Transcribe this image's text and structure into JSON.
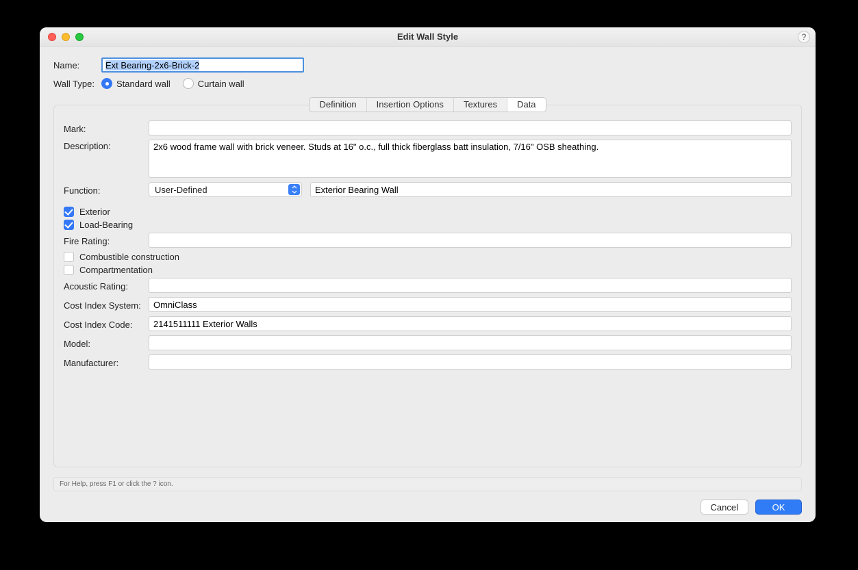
{
  "title": "Edit Wall Style",
  "name_label": "Name:",
  "name_value": "Ext Bearing-2x6-Brick-2",
  "wall_type_label": "Wall Type:",
  "wall_type": {
    "standard": "Standard wall",
    "curtain": "Curtain wall"
  },
  "tabs": {
    "definition": "Definition",
    "insertion": "Insertion Options",
    "textures": "Textures",
    "data": "Data"
  },
  "labels": {
    "mark": "Mark:",
    "description": "Description:",
    "function": "Function:",
    "exterior": "Exterior",
    "load_bearing": "Load-Bearing",
    "fire_rating": "Fire Rating:",
    "combustible": "Combustible construction",
    "compartmentation": "Compartmentation",
    "acoustic": "Acoustic Rating:",
    "cost_system": "Cost Index System:",
    "cost_code": "Cost Index Code:",
    "model": "Model:",
    "manufacturer": "Manufacturer:"
  },
  "values": {
    "mark": "",
    "description": "2x6 wood frame wall with brick veneer. Studs at 16\" o.c., full thick fiberglass batt insulation, 7/16\" OSB sheathing.",
    "function_select": "User-Defined",
    "function_text": "Exterior Bearing Wall",
    "fire_rating": "",
    "acoustic": "",
    "cost_system": "OmniClass",
    "cost_code": "2141511111 Exterior Walls",
    "model": "",
    "manufacturer": ""
  },
  "status": "For Help, press F1 or click the ? icon.",
  "buttons": {
    "cancel": "Cancel",
    "ok": "OK"
  }
}
